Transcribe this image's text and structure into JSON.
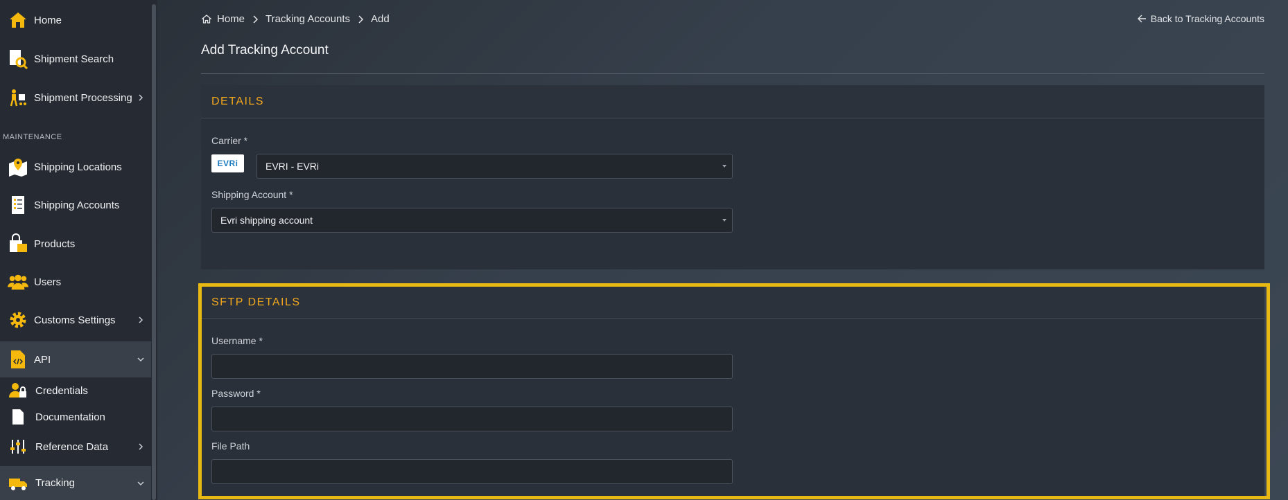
{
  "sidebar": {
    "items": [
      {
        "label": "Home",
        "icon": "home-icon"
      },
      {
        "label": "Shipment Search",
        "icon": "document-search-icon"
      },
      {
        "label": "Shipment Processing",
        "icon": "worker-cart-icon"
      },
      {
        "label": "Shipping Locations",
        "icon": "map-pin-icon"
      },
      {
        "label": "Shipping Accounts",
        "icon": "list-icon"
      },
      {
        "label": "Products",
        "icon": "shopping-bag-icon"
      },
      {
        "label": "Users",
        "icon": "users-icon"
      },
      {
        "label": "Customs Settings",
        "icon": "gear-icon"
      },
      {
        "label": "API",
        "icon": "code-file-icon"
      },
      {
        "label": "Credentials",
        "icon": "user-lock-icon"
      },
      {
        "label": "Documentation",
        "icon": "file-icon"
      },
      {
        "label": "Reference Data",
        "icon": "sliders-icon"
      },
      {
        "label": "Tracking",
        "icon": "truck-icon"
      }
    ],
    "section_maintenance": "MAINTENANCE"
  },
  "breadcrumb": {
    "home": "Home",
    "level1": "Tracking Accounts",
    "level2": "Add"
  },
  "back_link": "Back to Tracking Accounts",
  "page_title": "Add Tracking Account",
  "details": {
    "header": "DETAILS",
    "carrier_label": "Carrier *",
    "carrier_logo_text": "EVRi",
    "carrier_value": "EVRI - EVRi",
    "shipping_account_label": "Shipping Account *",
    "shipping_account_value": "Evri shipping account"
  },
  "sftp": {
    "header": "SFTP DETAILS",
    "username_label": "Username *",
    "username_value": "",
    "password_label": "Password *",
    "password_value": "",
    "filepath_label": "File Path",
    "filepath_value": ""
  },
  "colors": {
    "accent": "#f2a81d",
    "highlight": "#e8b913",
    "icon": "#f5b80c"
  }
}
